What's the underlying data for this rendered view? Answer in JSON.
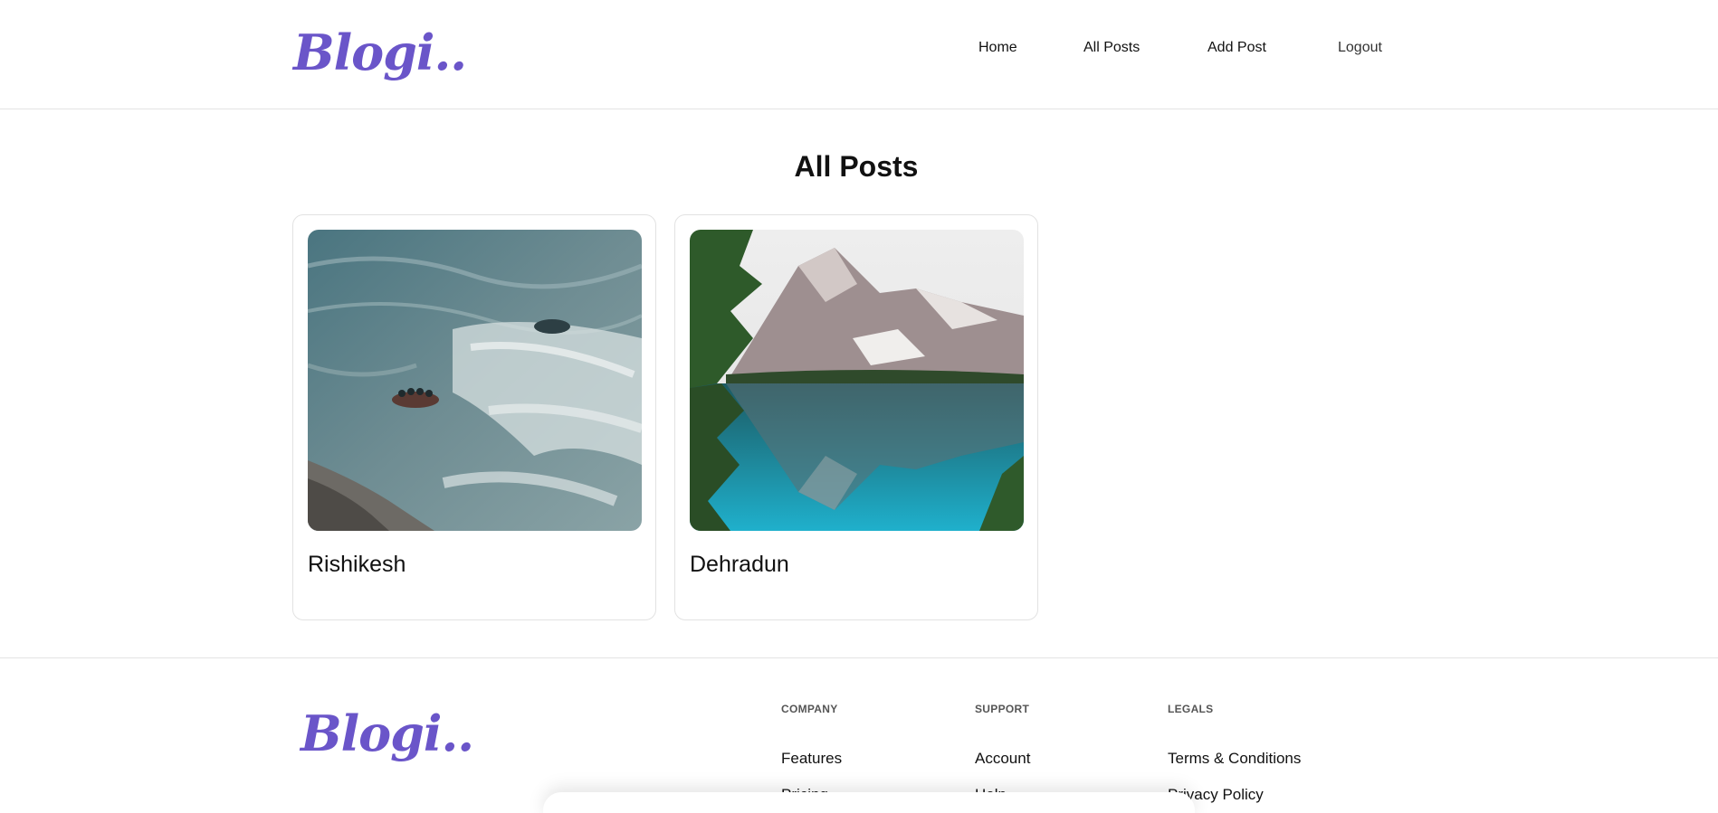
{
  "brand": {
    "logo_text": "Blogi..",
    "accent": "#6a55c9"
  },
  "nav": {
    "items": [
      {
        "label": "Home"
      },
      {
        "label": "All Posts"
      },
      {
        "label": "Add Post"
      },
      {
        "label": "Logout"
      }
    ]
  },
  "main": {
    "title": "All Posts",
    "posts": [
      {
        "title": "Rishikesh",
        "image": "river-rafting-photo"
      },
      {
        "title": "Dehradun",
        "image": "mountain-lake-photo"
      }
    ]
  },
  "footer": {
    "logo_text": "Blogi..",
    "columns": [
      {
        "heading": "COMPANY",
        "links": [
          "Features",
          "Pricing"
        ]
      },
      {
        "heading": "SUPPORT",
        "links": [
          "Account",
          "Help"
        ]
      },
      {
        "heading": "LEGALS",
        "links": [
          "Terms & Conditions",
          "Privacy Policy"
        ]
      }
    ]
  }
}
